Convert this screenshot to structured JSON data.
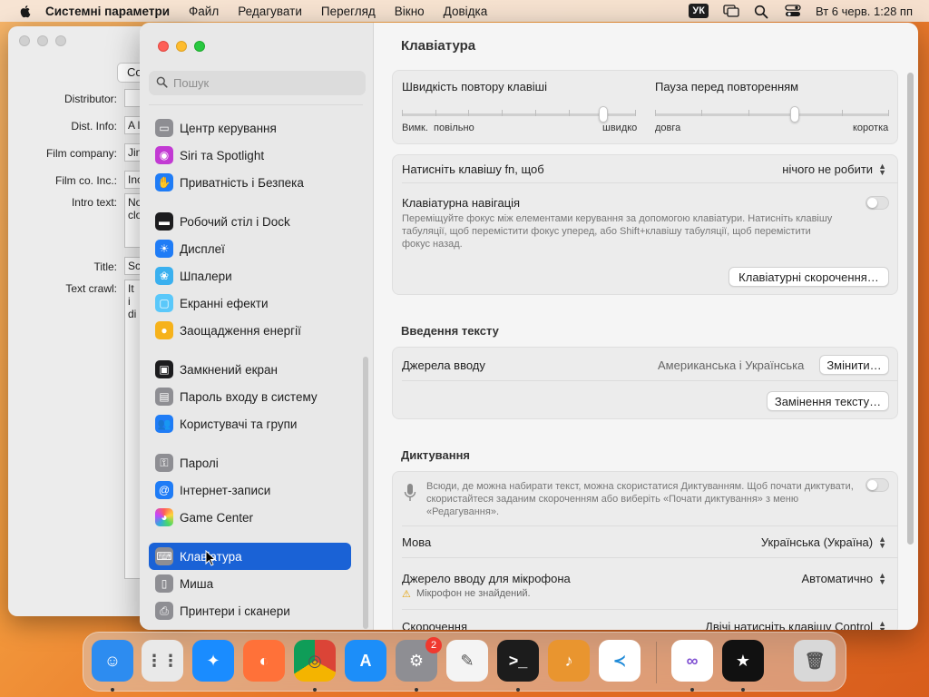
{
  "menubar": {
    "app_name": "Системні параметри",
    "menus": [
      "Файл",
      "Редагувати",
      "Перегляд",
      "Вікно",
      "Довідка"
    ],
    "lang": "УК",
    "clock": "Вт 6 черв.  1:28 пп"
  },
  "bg_window": {
    "button": "Co",
    "fields": [
      {
        "label": "Distributor:",
        "value": ""
      },
      {
        "label": "Dist. Info:",
        "value": "A l"
      },
      {
        "label": "Film company:",
        "value": "Jin"
      },
      {
        "label": "Film co. Inc.:",
        "value": "Inc"
      },
      {
        "label": "Intro text:",
        "value": "No clo"
      },
      {
        "label": "Title:",
        "value": "Sc"
      },
      {
        "label": "Text crawl:",
        "value": "It i di"
      }
    ]
  },
  "sidebar": {
    "search_placeholder": "Пошук",
    "items": [
      {
        "label": "Центр керування",
        "icon": "control-center-icon",
        "color": "#8e8e93"
      },
      {
        "label": "Siri та Spotlight",
        "icon": "siri-icon",
        "color": "#c23ad3"
      },
      {
        "label": "Приватність і Безпека",
        "icon": "hand-icon",
        "color": "#1f7cf6"
      },
      {
        "label": "Робочий стіл і Dock",
        "icon": "dock-icon",
        "color": "#1c1c1e"
      },
      {
        "label": "Дисплеї",
        "icon": "sun-icon",
        "color": "#1f7cf6"
      },
      {
        "label": "Шпалери",
        "icon": "wallpaper-icon",
        "color": "#3ab0ef"
      },
      {
        "label": "Екранні ефекти",
        "icon": "screensaver-icon",
        "color": "#5ac8fa"
      },
      {
        "label": "Заощадження енергії",
        "icon": "bulb-icon",
        "color": "#f6b21b"
      },
      {
        "label": "Замкнений екран",
        "icon": "lock-screen-icon",
        "color": "#1c1c1e"
      },
      {
        "label": "Пароль входу в систему",
        "icon": "lock-icon",
        "color": "#8e8e93"
      },
      {
        "label": "Користувачі та групи",
        "icon": "users-icon",
        "color": "#1f7cf6"
      },
      {
        "label": "Паролі",
        "icon": "key-icon",
        "color": "#8e8e93"
      },
      {
        "label": "Інтернет-записи",
        "icon": "at-icon",
        "color": "#1f7cf6"
      },
      {
        "label": "Game Center",
        "icon": "game-center-icon",
        "color": "#ffffff"
      },
      {
        "label": "Клавіатура",
        "icon": "keyboard-icon",
        "color": "#8e8e93"
      },
      {
        "label": "Миша",
        "icon": "mouse-icon",
        "color": "#8e8e93"
      },
      {
        "label": "Принтери і сканери",
        "icon": "printer-icon",
        "color": "#8e8e93"
      }
    ],
    "selected_index": 14
  },
  "content": {
    "title": "Клавіатура",
    "repeat_rate": {
      "label": "Швидкість повтору клавіші",
      "left": "Вимк.",
      "mid": "повільно",
      "right": "швидко",
      "value": 0.875
    },
    "repeat_delay": {
      "label": "Пауза перед повторенням",
      "left": "довга",
      "right": "коротка",
      "value": 0.6
    },
    "fn_key": {
      "label": "Натисніть клавішу fn, щоб",
      "value": "нічого не робити"
    },
    "keyboard_nav": {
      "label": "Клавіатурна навігація",
      "desc": "Переміщуйте фокус між елементами керування за допомогою клавіатури. Натисніть клавішу табуляції, щоб перемістити фокус уперед, або Shift+клавішу табуляції, щоб перемістити фокус назад.",
      "enabled": false
    },
    "shortcuts_button": "Клавіатурні скорочення…",
    "text_input": {
      "section": "Введення тексту",
      "sources_label": "Джерела вводу",
      "sources_value": "Американська і Українська",
      "edit_button": "Змінити…",
      "replace_button": "Замінення тексту…"
    },
    "dictation": {
      "section": "Диктування",
      "desc": "Всюди, де можна набирати текст, можна скористатися Диктуванням. Щоб почати диктувати, скористайтеся заданим скороченням або виберіть «Почати диктування» з меню «Редагування».",
      "enabled": false,
      "language_label": "Мова",
      "language_value": "Українська (Україна)",
      "mic_label": "Джерело вводу для мікрофона",
      "mic_value": "Автоматично",
      "mic_warning": "Мікрофон не знайдений.",
      "shortcut_label": "Скорочення",
      "shortcut_value": "Двічі натисніть клавішу Control"
    }
  },
  "dock": {
    "apps": [
      {
        "name": "finder",
        "color": "#2d8cf0"
      },
      {
        "name": "launchpad",
        "color": "#e9e9e9"
      },
      {
        "name": "safari",
        "color": "#1a8cff"
      },
      {
        "name": "firefox",
        "color": "#ff7139"
      },
      {
        "name": "chrome",
        "color": "#ffffff"
      },
      {
        "name": "app-store",
        "color": "#1c8ef9"
      },
      {
        "name": "system-settings",
        "color": "#8e8e93"
      },
      {
        "name": "textedit",
        "color": "#f4f4f4"
      },
      {
        "name": "terminal",
        "color": "#1c1c1c"
      },
      {
        "name": "garageband",
        "color": "#e9952f"
      },
      {
        "name": "vscode",
        "color": "#ffffff"
      },
      {
        "name": "visual-studio",
        "color": "#ffffff"
      },
      {
        "name": "movie-credits",
        "color": "#111111"
      },
      {
        "name": "trash",
        "color": "#d8d8d8"
      }
    ],
    "settings_badge": "2"
  }
}
